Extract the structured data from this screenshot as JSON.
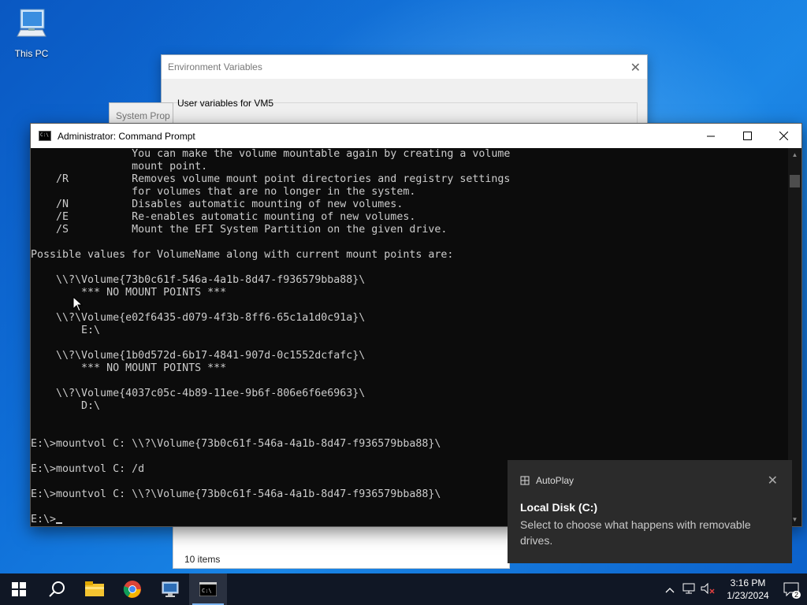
{
  "desktop": {
    "icons": [
      {
        "label": "This PC",
        "icon": "computer-icon"
      }
    ]
  },
  "env_window": {
    "title": "Environment Variables",
    "group_label": "User variables for VM5"
  },
  "system_window": {
    "title": "System Prop"
  },
  "explorer_window": {
    "status": "10 items"
  },
  "cmd": {
    "title": "Administrator: Command Prompt",
    "lines": [
      "                You can make the volume mountable again by creating a volume",
      "                mount point.",
      "    /R          Removes volume mount point directories and registry settings",
      "                for volumes that are no longer in the system.",
      "    /N          Disables automatic mounting of new volumes.",
      "    /E          Re-enables automatic mounting of new volumes.",
      "    /S          Mount the EFI System Partition on the given drive.",
      "",
      "Possible values for VolumeName along with current mount points are:",
      "",
      "    \\\\?\\Volume{73b0c61f-546a-4a1b-8d47-f936579bba88}\\",
      "        *** NO MOUNT POINTS ***",
      "",
      "    \\\\?\\Volume{e02f6435-d079-4f3b-8ff6-65c1a1d0c91a}\\",
      "        E:\\",
      "",
      "    \\\\?\\Volume{1b0d572d-6b17-4841-907d-0c1552dcfafc}\\",
      "        *** NO MOUNT POINTS ***",
      "",
      "    \\\\?\\Volume{4037c05c-4b89-11ee-9b6f-806e6f6e6963}\\",
      "        D:\\",
      "",
      "",
      "E:\\>mountvol C: \\\\?\\Volume{73b0c61f-546a-4a1b-8d47-f936579bba88}\\",
      "",
      "E:\\>mountvol C: /d",
      "",
      "E:\\>mountvol C: \\\\?\\Volume{73b0c61f-546a-4a1b-8d47-f936579bba88}\\",
      ""
    ],
    "prompt": "E:\\>"
  },
  "toast": {
    "app": "AutoPlay",
    "heading": "Local Disk (C:)",
    "message": "Select to choose what happens with removable drives."
  },
  "taskbar": {
    "items": [
      "start-icon",
      "search-icon",
      "file-explorer-icon",
      "chrome-icon",
      "server-manager-icon",
      "command-prompt-icon"
    ],
    "time": "3:16 PM",
    "date": "1/23/2024",
    "notification_count": "2"
  }
}
